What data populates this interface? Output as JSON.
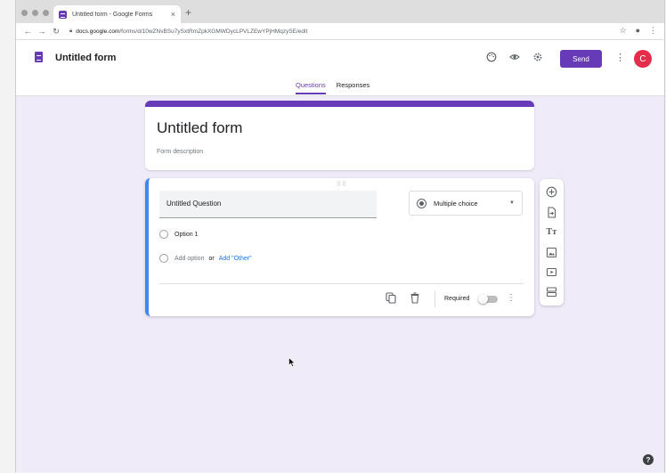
{
  "browser": {
    "tab_title": "Untitled form - Google Forms",
    "tab_close": "×",
    "new_tab": "+",
    "url_domain": "docs.google.com",
    "url_path": "/forms/d/10wZNvBSu7ySxtRmZpkXGMWDycLPVLZEwYPjHMqzySE/edit"
  },
  "header": {
    "doc_title": "Untitled form",
    "send_label": "Send",
    "avatar_initial": "C",
    "tabs": [
      {
        "label": "Questions",
        "active": true
      },
      {
        "label": "Responses",
        "active": false
      }
    ]
  },
  "form": {
    "title": "Untitled form",
    "description_placeholder": "Form description"
  },
  "question": {
    "title": "Untitled Question",
    "type": "Multiple choice",
    "options": [
      "Option 1"
    ],
    "add_option": "Add option",
    "or": "or",
    "add_other": "Add \"Other\"",
    "required_label": "Required",
    "required": false
  },
  "side_toolbar": [
    "add-question-icon",
    "import-questions-icon",
    "add-title-icon",
    "add-image-icon",
    "add-video-icon",
    "add-section-icon"
  ],
  "colors": {
    "accent": "#673ab7",
    "background": "#f0ebf8",
    "active_border": "#4285f4",
    "avatar": "#e52d4b",
    "link": "#1a73e8"
  },
  "help": "?"
}
